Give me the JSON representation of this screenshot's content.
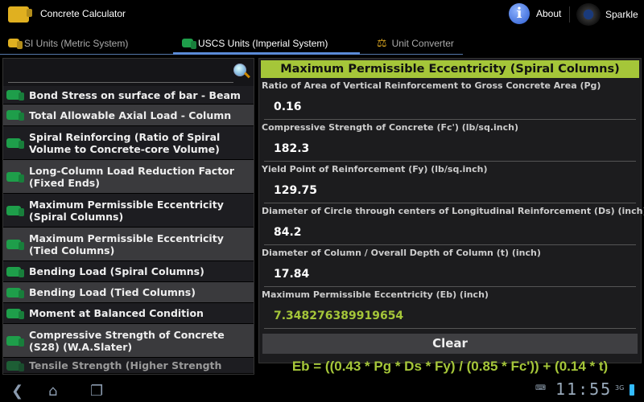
{
  "app": {
    "title": "Concrete Calculator",
    "about_label": "About",
    "sparkle_label": "Sparkle",
    "sparkle_logo_text": "SPARKLE"
  },
  "tabs": [
    {
      "label": "SI Units (Metric System)",
      "active": false
    },
    {
      "label": "USCS Units (Imperial System)",
      "active": true
    },
    {
      "label": "Unit Converter",
      "active": false
    }
  ],
  "search": {
    "value": "",
    "placeholder": ""
  },
  "list_items": [
    "Bond Stress on surface of bar - Beam",
    "Total Allowable Axial Load - Column",
    "Spiral Reinforcing (Ratio of Spiral Volume to Concrete-core Volume)",
    "Long-Column Load Reduction Factor (Fixed Ends)",
    "Maximum Permissible Eccentricity (Spiral Columns)",
    "Maximum Permissible Eccentricity (Tied Columns)",
    "Bending Load (Spiral Columns)",
    "Bending Load (Tied Columns)",
    "Moment at Balanced Condition",
    "Compressive Strength of Concrete (S28) (W.A.Slater)",
    "Tensile Strength (Higher Strength"
  ],
  "calculator": {
    "title": "Maximum Permissible Eccentricity (Spiral Columns)",
    "fields": [
      {
        "label": "Ratio of Area of Vertical Reinforcement to Gross Concrete Area (Pg)",
        "value": "0.16"
      },
      {
        "label": "Compressive Strength of Concrete (Fc') (lb/sq.inch)",
        "value": "182.3"
      },
      {
        "label": "Yield Point of Reinforcement (Fy) (lb/sq.inch)",
        "value": "129.75"
      },
      {
        "label": "Diameter of Circle through centers of Longitudinal Reinforcement (Ds) (inch)",
        "value": "84.2"
      },
      {
        "label": "Diameter of Column / Overall Depth of Column (t) (inch)",
        "value": "17.84"
      }
    ],
    "result": {
      "label": "Maximum Permissible Eccentricity (Eb) (inch)",
      "value": "7.348276389919654"
    },
    "clear_label": "Clear",
    "formula": "Eb = ((0.43 * Pg * Ds * Fy) / (0.85 * Fc')) + (0.14 * t)"
  },
  "status_bar": {
    "time": "11:55",
    "network": "3G"
  },
  "colors": {
    "accent": "#a5c639",
    "tab_indicator": "#5b8bd8"
  }
}
